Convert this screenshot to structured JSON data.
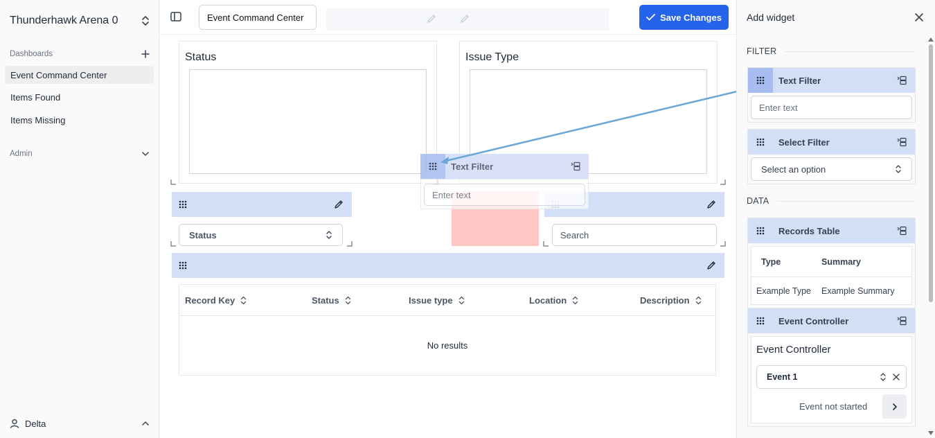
{
  "sidebar": {
    "workspace_name": "Thunderhawk Arena 0",
    "dashboards_label": "Dashboards",
    "items": [
      {
        "label": "Event Command Center",
        "active": true
      },
      {
        "label": "Items Found",
        "active": false
      },
      {
        "label": "Items Missing",
        "active": false
      }
    ],
    "admin_label": "Admin",
    "user_name": "Delta"
  },
  "topbar": {
    "dashboard_title_value": "Event Command Center",
    "save_label": "Save Changes"
  },
  "canvas": {
    "status_chart_title": "Status",
    "issue_type_chart_title": "Issue Type",
    "status_select_value": "Status",
    "search_placeholder": "Search",
    "table": {
      "columns": [
        "Record Key",
        "Status",
        "Issue type",
        "Location",
        "Description"
      ],
      "empty_text": "No results"
    },
    "drag_preview": {
      "title": "Text Filter",
      "placeholder": "Enter text"
    }
  },
  "panel": {
    "title": "Add widget",
    "filter_group": "FILTER",
    "data_group": "DATA",
    "text_filter": {
      "title": "Text Filter",
      "placeholder": "Enter text"
    },
    "select_filter": {
      "title": "Select Filter",
      "placeholder": "Select an option"
    },
    "records_table": {
      "title": "Records Table",
      "headers": [
        "Type",
        "Summary"
      ],
      "row": [
        "Example Type",
        "Example Summary"
      ]
    },
    "event_controller": {
      "title": "Event Controller",
      "heading": "Event Controller",
      "selected_event": "Event 1",
      "status": "Event not started"
    }
  },
  "colors": {
    "accent": "#2563eb",
    "widget_header": "#d3def7",
    "grip_active": "#a8bcef",
    "drop_zone": "#ffc6c4",
    "drag_arrow": "#6aa6d6"
  }
}
